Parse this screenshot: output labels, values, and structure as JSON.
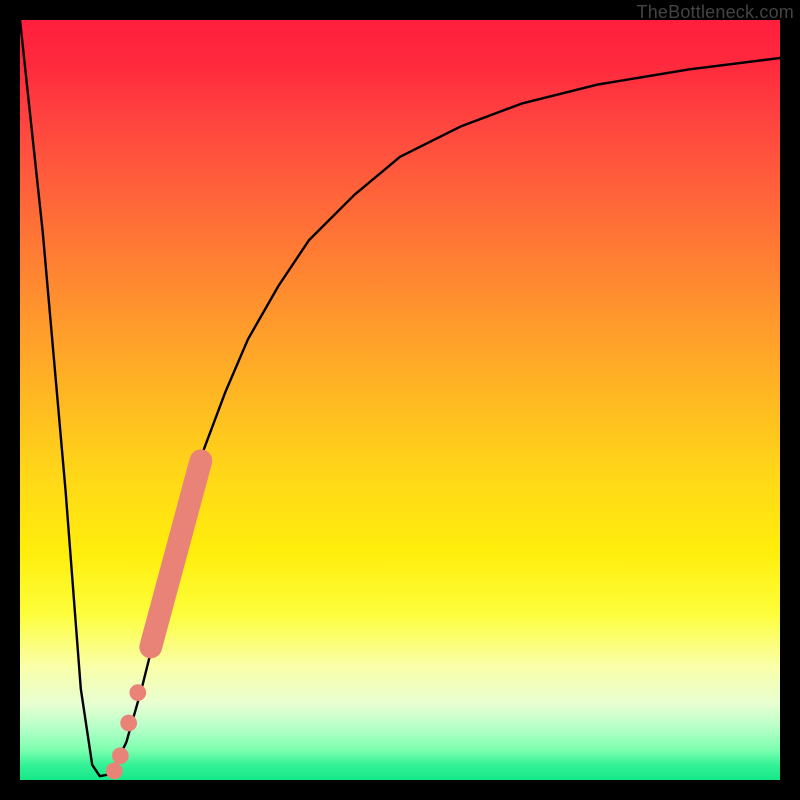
{
  "attribution": "TheBottleneck.com",
  "colors": {
    "curve_stroke": "#000000",
    "marker_fill": "#e98378",
    "background_black": "#000000"
  },
  "chart_data": {
    "type": "line",
    "title": "",
    "xlabel": "",
    "ylabel": "",
    "xlim": [
      0,
      100
    ],
    "ylim": [
      0,
      100
    ],
    "grid": false,
    "legend": false,
    "series": [
      {
        "name": "bottleneck-curve",
        "x": [
          0,
          3,
          6,
          8,
          9.5,
          10.5,
          12,
          14,
          16,
          18,
          20,
          22,
          24,
          27,
          30,
          34,
          38,
          44,
          50,
          58,
          66,
          76,
          88,
          100
        ],
        "y": [
          100,
          72,
          38,
          12,
          2,
          0.5,
          0.8,
          5,
          12,
          20,
          29,
          36,
          43,
          51,
          58,
          65,
          71,
          77,
          82,
          86,
          89,
          91.5,
          93.5,
          95
        ]
      }
    ],
    "markers": [
      {
        "name": "highlight-segment-upper",
        "type": "segment",
        "x0": 17.2,
        "y0": 17.5,
        "x1": 23.8,
        "y1": 42.0,
        "radius": 1.5
      },
      {
        "name": "marker-a",
        "type": "point",
        "x": 15.5,
        "y": 11.5,
        "r": 1.1
      },
      {
        "name": "marker-b",
        "type": "point",
        "x": 14.3,
        "y": 7.5,
        "r": 1.1
      },
      {
        "name": "marker-c",
        "type": "point",
        "x": 13.2,
        "y": 3.2,
        "r": 1.1
      },
      {
        "name": "marker-d",
        "type": "point",
        "x": 12.4,
        "y": 1.2,
        "r": 1.1
      }
    ]
  }
}
